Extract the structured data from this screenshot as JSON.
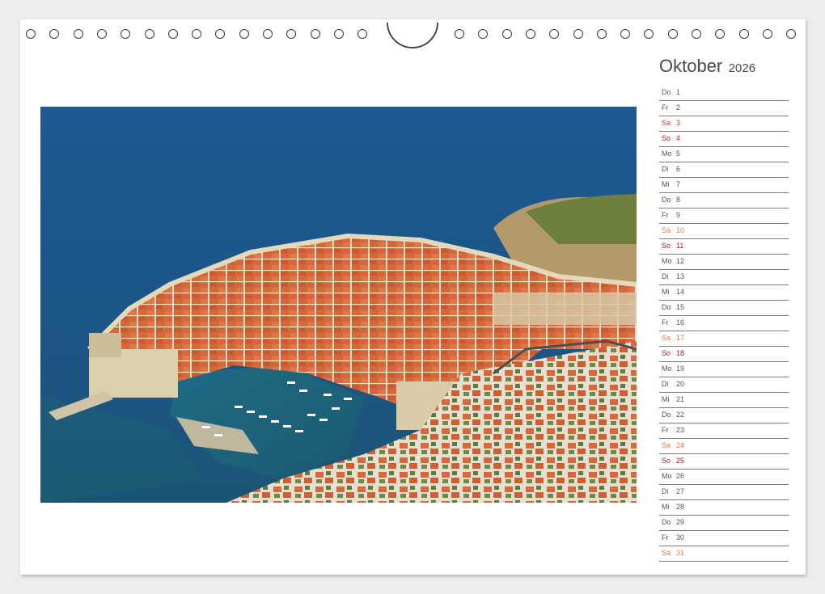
{
  "calendar": {
    "month": "Oktober",
    "year": "2026"
  },
  "photo": {
    "subject": "aerial-view-old-town-harbour"
  },
  "colors": {
    "weekday": "#555555",
    "saturday": "#c0392b",
    "sunday": "#a8181c",
    "holiday": "#e8754a"
  },
  "days": [
    {
      "wd": "Do",
      "d": "1",
      "type": "weekday"
    },
    {
      "wd": "Fr",
      "d": "2",
      "type": "weekday"
    },
    {
      "wd": "Sa",
      "d": "3",
      "type": "sat"
    },
    {
      "wd": "So",
      "d": "4",
      "type": "sun"
    },
    {
      "wd": "Mo",
      "d": "5",
      "type": "weekday"
    },
    {
      "wd": "Di",
      "d": "6",
      "type": "weekday"
    },
    {
      "wd": "Mi",
      "d": "7",
      "type": "weekday"
    },
    {
      "wd": "Do",
      "d": "8",
      "type": "weekday"
    },
    {
      "wd": "Fr",
      "d": "9",
      "type": "weekday"
    },
    {
      "wd": "Sa",
      "d": "10",
      "type": "holiday"
    },
    {
      "wd": "So",
      "d": "11",
      "type": "sun"
    },
    {
      "wd": "Mo",
      "d": "12",
      "type": "weekday"
    },
    {
      "wd": "Di",
      "d": "13",
      "type": "weekday"
    },
    {
      "wd": "Mi",
      "d": "14",
      "type": "weekday"
    },
    {
      "wd": "Do",
      "d": "15",
      "type": "weekday"
    },
    {
      "wd": "Fr",
      "d": "16",
      "type": "weekday"
    },
    {
      "wd": "Sa",
      "d": "17",
      "type": "holiday"
    },
    {
      "wd": "So",
      "d": "18",
      "type": "sun"
    },
    {
      "wd": "Mo",
      "d": "19",
      "type": "weekday"
    },
    {
      "wd": "Di",
      "d": "20",
      "type": "weekday"
    },
    {
      "wd": "Mi",
      "d": "21",
      "type": "weekday"
    },
    {
      "wd": "Do",
      "d": "22",
      "type": "weekday"
    },
    {
      "wd": "Fr",
      "d": "23",
      "type": "weekday"
    },
    {
      "wd": "Sa",
      "d": "24",
      "type": "holiday"
    },
    {
      "wd": "So",
      "d": "25",
      "type": "sun"
    },
    {
      "wd": "Mo",
      "d": "26",
      "type": "weekday"
    },
    {
      "wd": "Di",
      "d": "27",
      "type": "weekday"
    },
    {
      "wd": "Mi",
      "d": "28",
      "type": "weekday"
    },
    {
      "wd": "Do",
      "d": "29",
      "type": "weekday"
    },
    {
      "wd": "Fr",
      "d": "30",
      "type": "weekday"
    },
    {
      "wd": "Sa",
      "d": "31",
      "type": "holiday"
    }
  ]
}
